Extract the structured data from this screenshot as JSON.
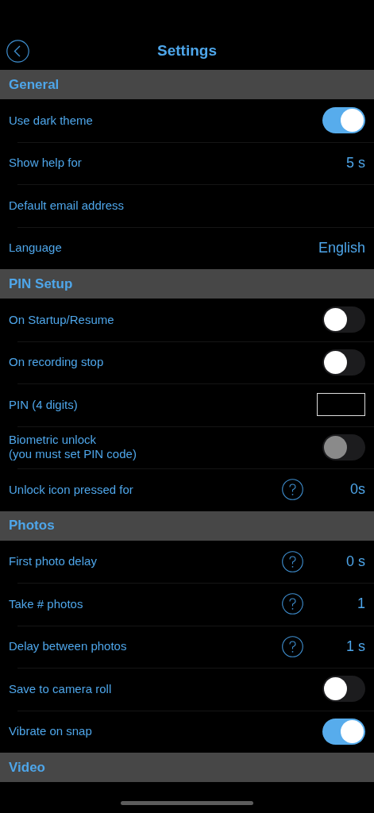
{
  "nav": {
    "title": "Settings"
  },
  "sections": [
    {
      "title": "General",
      "rows": [
        {
          "kind": "toggle",
          "label": "Use dark theme",
          "on": true,
          "disabled": false
        },
        {
          "kind": "value",
          "label": "Show help for",
          "value": "5 s"
        },
        {
          "kind": "plain",
          "label": "Default email address"
        },
        {
          "kind": "value",
          "label": "Language",
          "value": "English"
        }
      ]
    },
    {
      "title": "PIN Setup",
      "rows": [
        {
          "kind": "toggle",
          "label": "On Startup/Resume",
          "on": false,
          "disabled": false
        },
        {
          "kind": "toggle",
          "label": "On recording stop",
          "on": false,
          "disabled": false
        },
        {
          "kind": "field",
          "label": "PIN (4 digits)"
        },
        {
          "kind": "toggle",
          "label": "Biometric unlock\n(you must set PIN code)",
          "on": false,
          "disabled": true
        },
        {
          "kind": "help",
          "label": "Unlock icon pressed for",
          "value": "0s"
        }
      ]
    },
    {
      "title": "Photos",
      "rows": [
        {
          "kind": "help",
          "label": "First photo delay",
          "value": "0 s"
        },
        {
          "kind": "help",
          "label": "Take # photos",
          "value": "1"
        },
        {
          "kind": "help",
          "label": "Delay between photos",
          "value": "1 s"
        },
        {
          "kind": "toggle",
          "label": "Save to camera roll",
          "on": false,
          "disabled": false
        },
        {
          "kind": "toggle",
          "label": "Vibrate on snap",
          "on": true,
          "disabled": false
        }
      ]
    },
    {
      "title": "Video"
    }
  ]
}
